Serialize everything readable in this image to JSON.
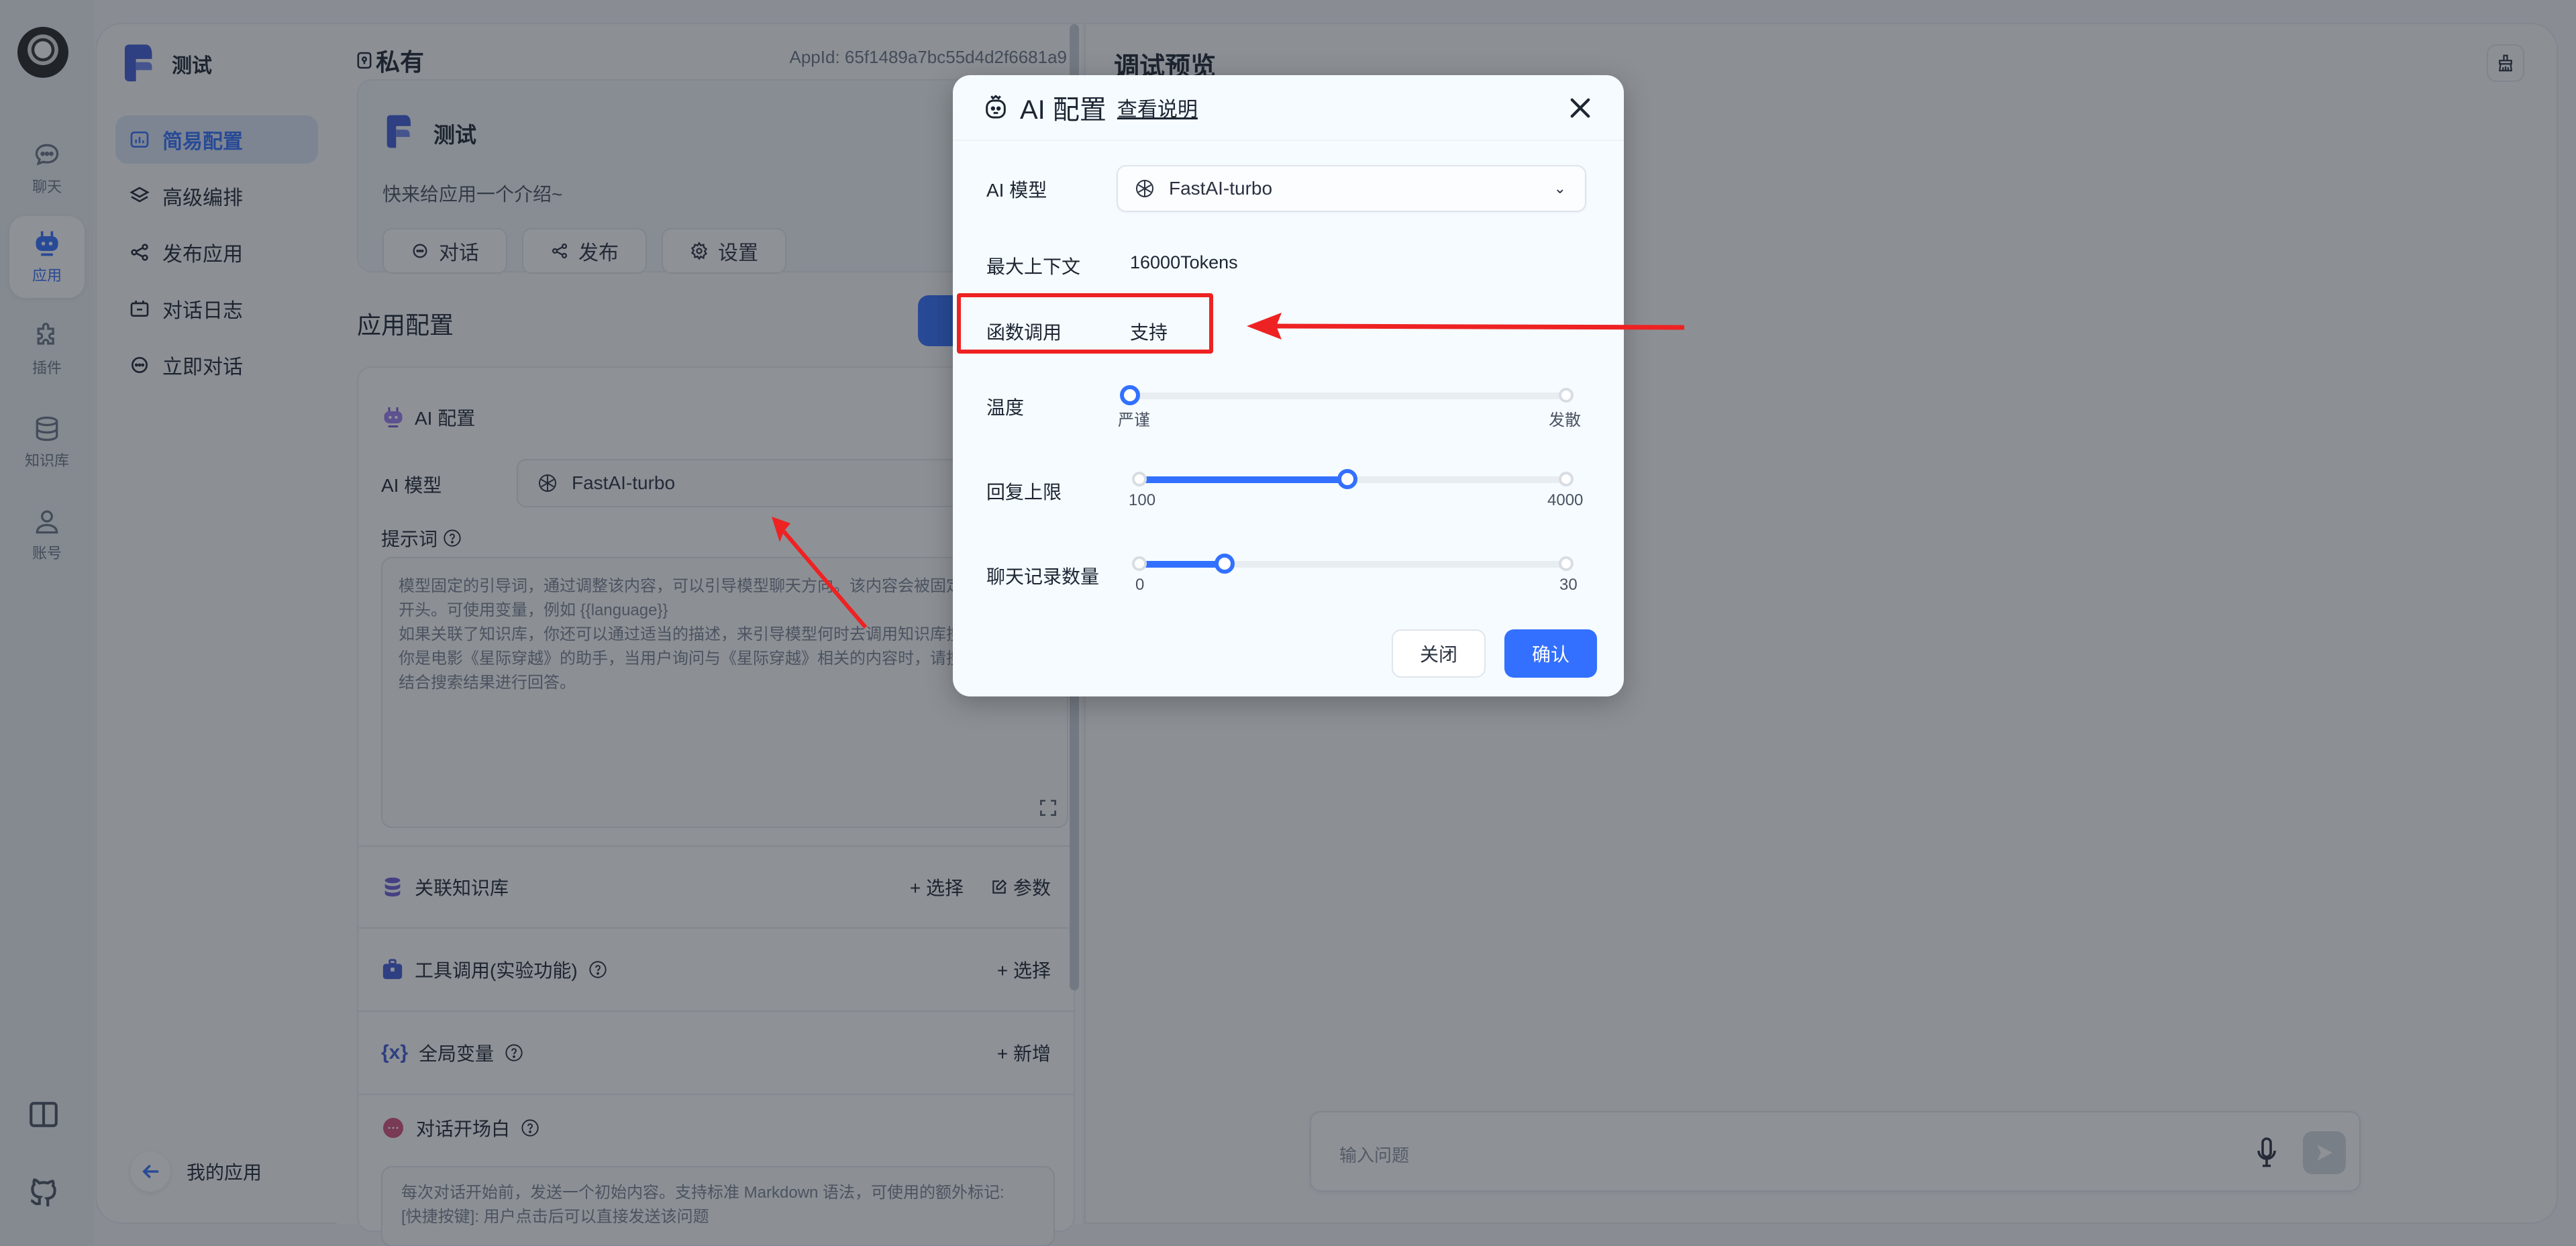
{
  "rail": {
    "items": [
      {
        "label": "聊天",
        "icon": "chat-icon"
      },
      {
        "label": "应用",
        "icon": "robot-icon",
        "active": true
      },
      {
        "label": "插件",
        "icon": "puzzle-icon"
      },
      {
        "label": "知识库",
        "icon": "database-icon"
      },
      {
        "label": "账号",
        "icon": "user-icon"
      }
    ],
    "bottom_icons": [
      "book-icon",
      "github-icon"
    ]
  },
  "sidebar": {
    "app_name": "测试",
    "items": [
      {
        "label": "简易配置",
        "icon": "chart-icon",
        "active": true
      },
      {
        "label": "高级编排",
        "icon": "layers-icon"
      },
      {
        "label": "发布应用",
        "icon": "share-icon"
      },
      {
        "label": "对话日志",
        "icon": "log-icon"
      },
      {
        "label": "立即对话",
        "icon": "chat-icon"
      }
    ],
    "back_label": "我的应用"
  },
  "middle": {
    "visibility": "私有",
    "app_id": "AppId: 65f1489a7bc55d4d2f6681a9",
    "app_card": {
      "name": "测试",
      "intro": "快来给应用一个介绍~",
      "buttons": [
        "对话",
        "发布",
        "设置"
      ]
    },
    "section_title": "应用配置",
    "ai_config": {
      "title": "AI 配置",
      "model_label": "AI 模型",
      "model_value": "FastAI-turbo",
      "prompt_label": "提示词",
      "prompt_placeholder": "模型固定的引导词，通过调整该内容，可以引导模型聊天方向。该内容会被固定在上下文的开头。可使用变量，例如 {{language}}\n如果关联了知识库，你还可以通过适当的描述，来引导模型何时去调用知识库搜索。例如:\n你是电影《星际穿越》的助手，当用户询问与《星际穿越》相关的内容时，请搜索知识库并结合搜索结果进行回答。"
    },
    "sections": [
      {
        "title": "关联知识库",
        "actions": [
          "+ 选择",
          "参数"
        ],
        "icon": "database-icon"
      },
      {
        "title": "工具调用(实验功能)",
        "actions": [
          "+ 选择"
        ],
        "icon": "toolbox-icon",
        "help": true
      },
      {
        "title": "全局变量",
        "actions": [
          "+ 新增"
        ],
        "icon": "variable-icon",
        "help": true
      }
    ],
    "greeting": {
      "title": "对话开场白",
      "placeholder": "每次对话开始前，发送一个初始内容。支持标准 Markdown 语法，可使用的额外标记:\n[快捷按键]: 用户点击后可以直接发送该问题"
    }
  },
  "preview": {
    "title": "调试预览",
    "input_placeholder": "输入问题"
  },
  "modal": {
    "title": "AI 配置",
    "help_link": "查看说明",
    "model_label": "AI 模型",
    "model_value": "FastAI-turbo",
    "max_context_label": "最大上下文",
    "max_context_value": "16000Tokens",
    "function_call_label": "函数调用",
    "function_call_value": "支持",
    "temperature": {
      "label": "温度",
      "min_label": "严谨",
      "max_label": "发散",
      "value_fraction": 0.0
    },
    "max_tokens": {
      "label": "回复上限",
      "min": 100,
      "max": 4000,
      "value": 2000
    },
    "history": {
      "label": "聊天记录数量",
      "min": 0,
      "max": 30,
      "value": 6
    },
    "cancel_label": "关闭",
    "confirm_label": "确认"
  },
  "colors": {
    "accent": "#3370ff",
    "annotation": "#ee2222"
  }
}
